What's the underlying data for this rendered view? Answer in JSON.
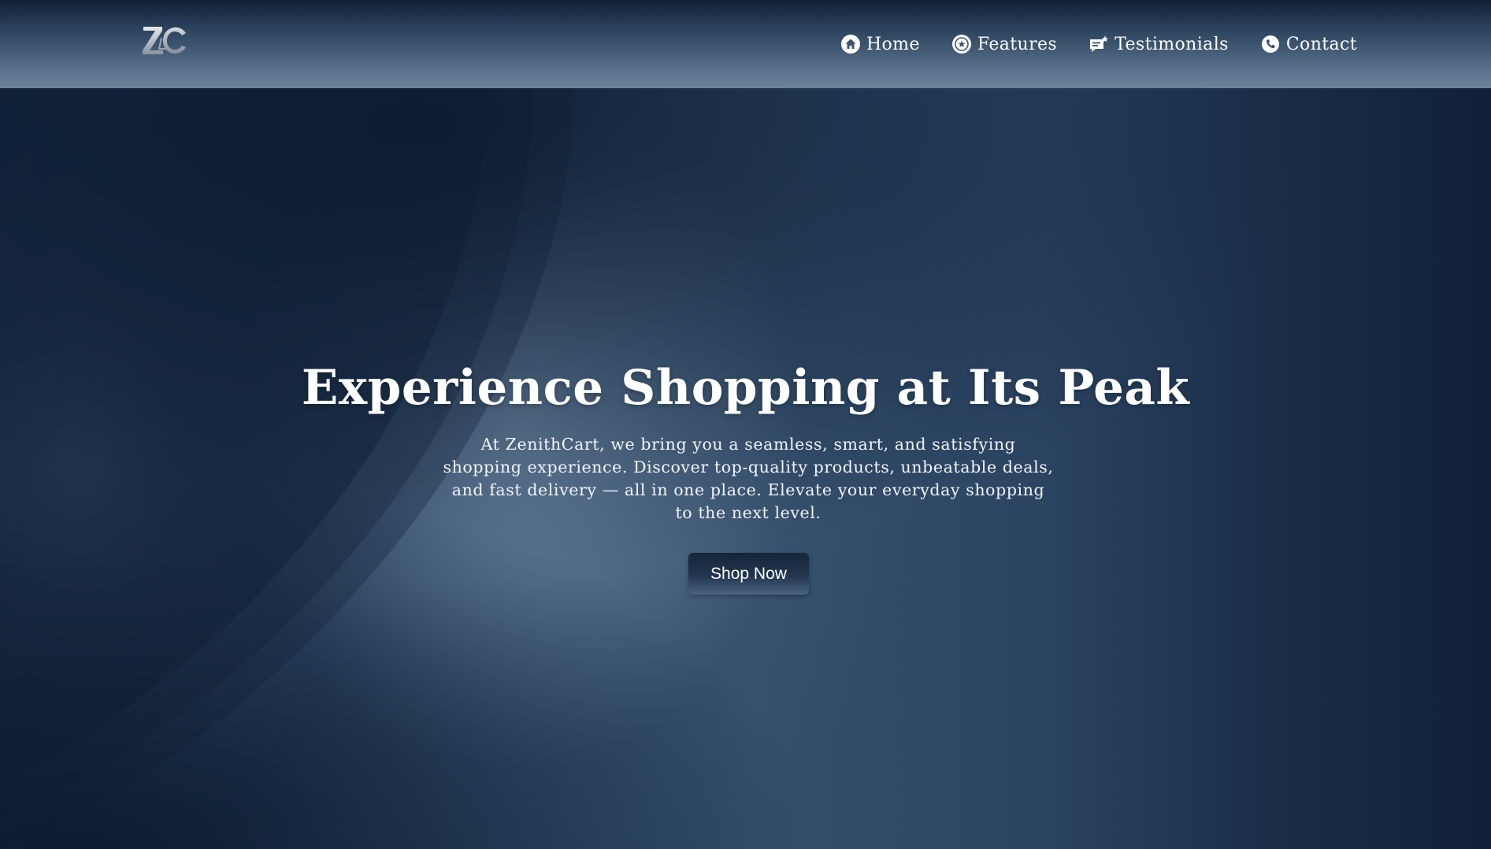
{
  "header": {
    "logo_text": "ZC",
    "nav": [
      {
        "label": "Home",
        "icon": "home-icon"
      },
      {
        "label": "Features",
        "icon": "features-icon"
      },
      {
        "label": "Testimonials",
        "icon": "testimonials-icon"
      },
      {
        "label": "Contact",
        "icon": "phone-icon"
      }
    ]
  },
  "hero": {
    "title": "Experience Shopping at Its Peak",
    "description": "At ZenithCart, we bring you a seamless, smart, and satisfying shopping experience. Discover top-quality products, unbeatable deals, and fast delivery — all in one place. Elevate your everyday shopping to the next level.",
    "cta_label": "Shop Now"
  },
  "colors": {
    "header_top": "#0f2036",
    "header_bottom": "#6d849c",
    "hero_dark": "#102039",
    "hero_light": "#708aa6",
    "button": "#1b2d44",
    "text": "#ffffff"
  }
}
